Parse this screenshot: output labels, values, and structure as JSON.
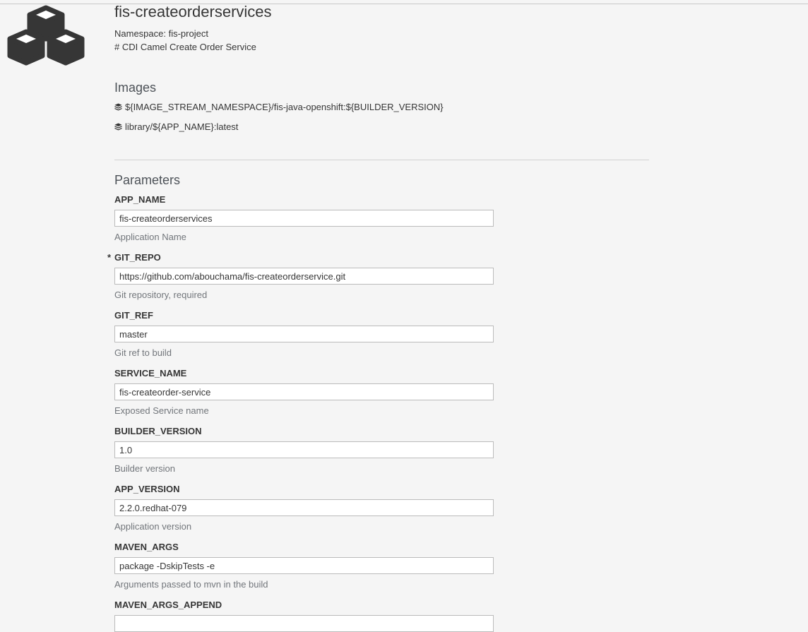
{
  "template": {
    "title": "fis-createorderservices",
    "namespace": "Namespace: fis-project",
    "description": "# CDI Camel Create Order Service"
  },
  "images_section": {
    "heading": "Images",
    "icon": "cube-icon",
    "items": [
      "${IMAGE_STREAM_NAMESPACE}/fis-java-openshift:${BUILDER_VERSION}",
      "library/${APP_NAME}:latest"
    ]
  },
  "parameters_section": {
    "heading": "Parameters",
    "required_marker": "*",
    "params": [
      {
        "name": "APP_NAME",
        "value": "fis-createorderservices",
        "help": "Application Name",
        "required": false
      },
      {
        "name": "GIT_REPO",
        "value": "https://github.com/abouchama/fis-createorderservice.git",
        "help": "Git repository, required",
        "required": true
      },
      {
        "name": "GIT_REF",
        "value": "master",
        "help": "Git ref to build",
        "required": false
      },
      {
        "name": "SERVICE_NAME",
        "value": "fis-createorder-service",
        "help": "Exposed Service name",
        "required": false
      },
      {
        "name": "BUILDER_VERSION",
        "value": "1.0",
        "help": "Builder version",
        "required": false
      },
      {
        "name": "APP_VERSION",
        "value": "2.2.0.redhat-079",
        "help": "Application version",
        "required": false
      },
      {
        "name": "MAVEN_ARGS",
        "value": "package -DskipTests -e",
        "help": "Arguments passed to mvn in the build",
        "required": false
      },
      {
        "name": "MAVEN_ARGS_APPEND",
        "value": "",
        "help": "",
        "required": false
      }
    ]
  },
  "colors": {
    "background": "#f5f5f5",
    "text": "#363636",
    "help_text": "#72767b",
    "input_border": "#bbbbbb",
    "logo": "#363636"
  }
}
